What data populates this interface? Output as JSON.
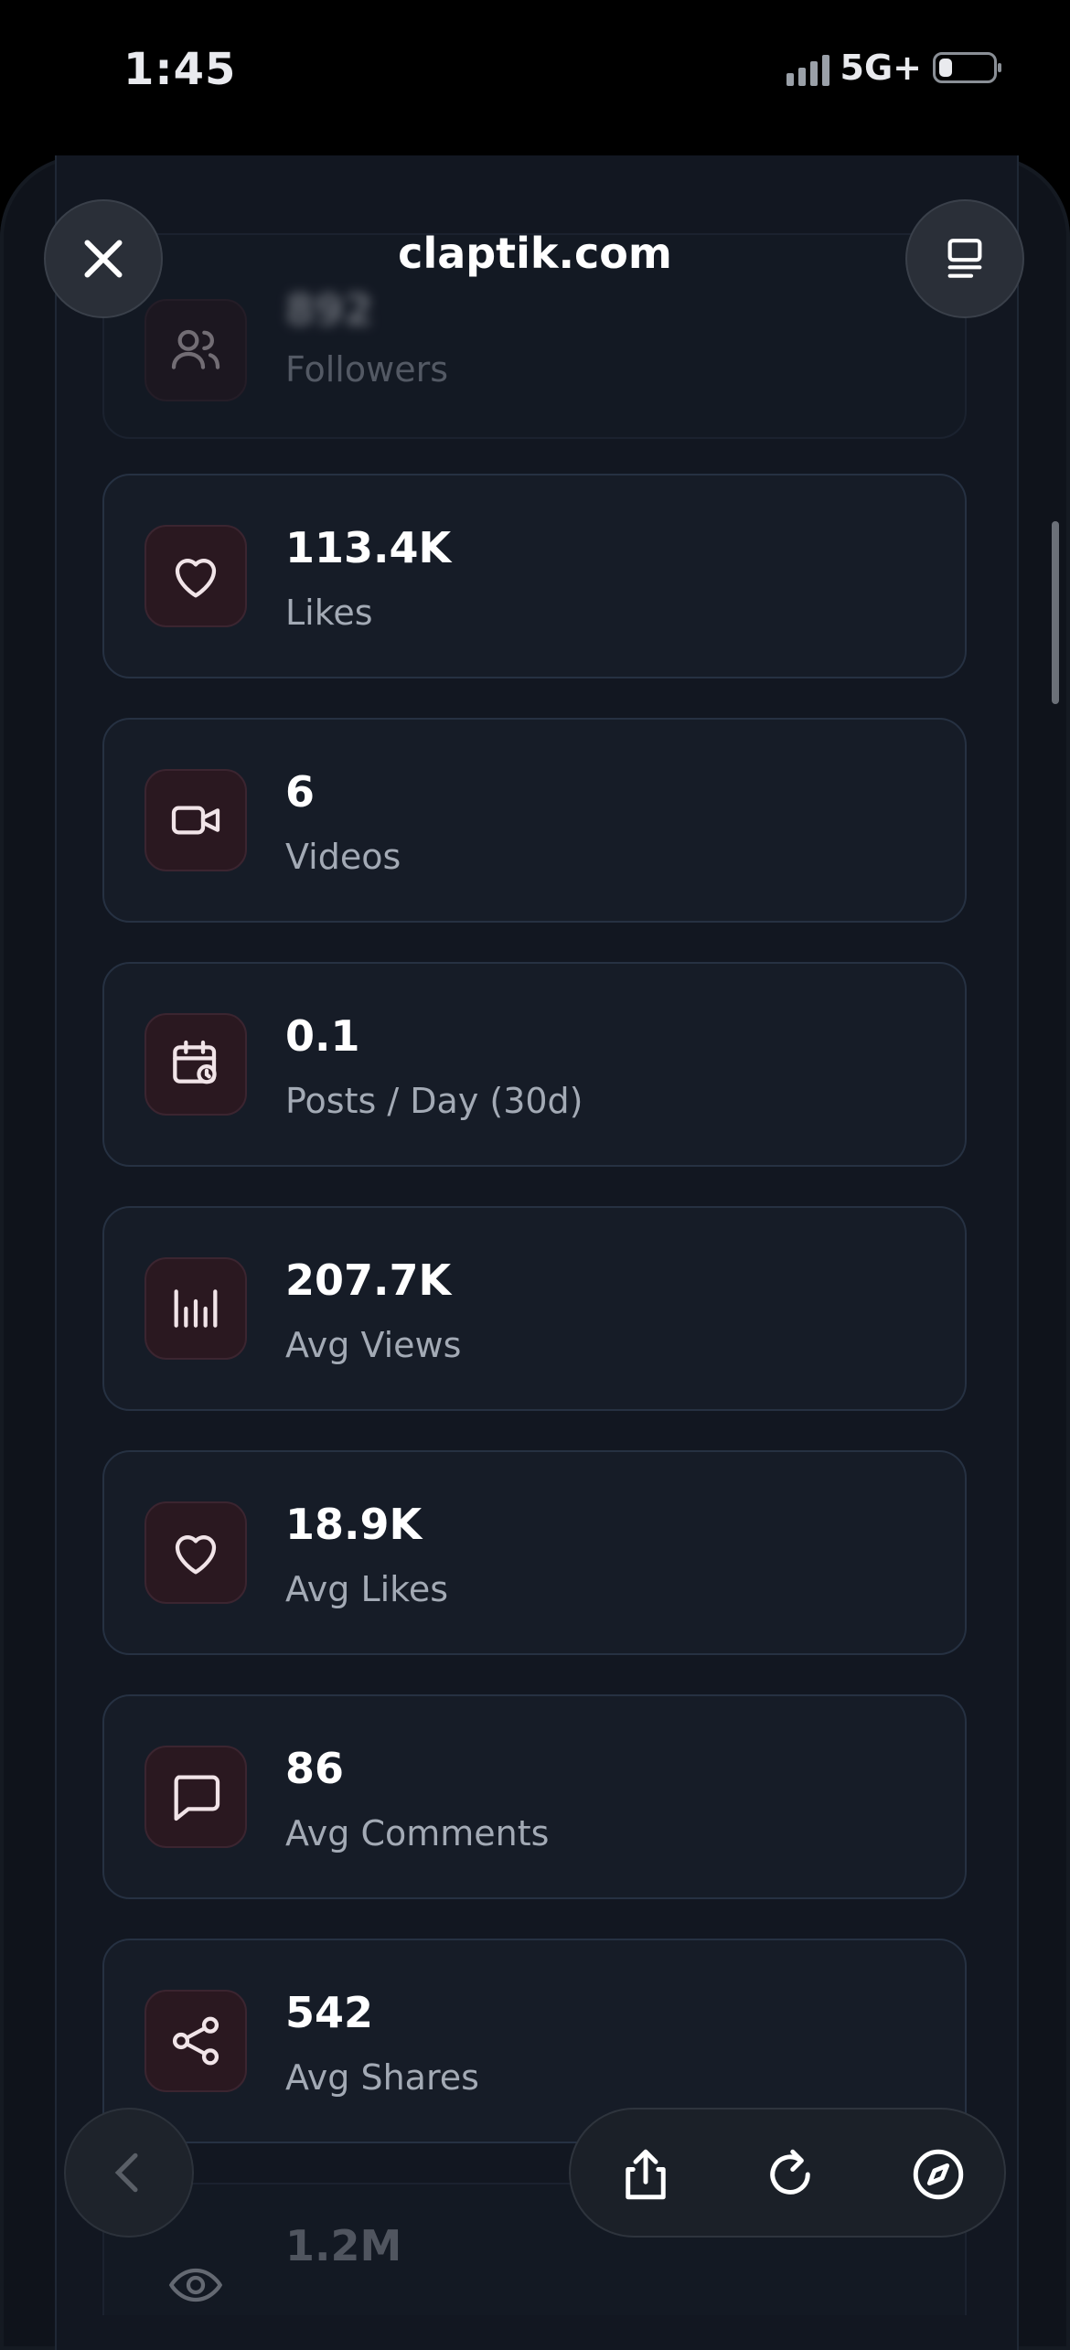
{
  "status_bar": {
    "time": "1:45",
    "network": "5G+"
  },
  "header": {
    "site": "claptik.com",
    "close_icon": "close-icon",
    "menu_icon": "reader-menu-icon"
  },
  "stats": [
    {
      "value": "892",
      "label": "Followers",
      "icon": "followers-icon"
    },
    {
      "value": "113.4K",
      "label": "Likes",
      "icon": "heart-icon"
    },
    {
      "value": "6",
      "label": "Videos",
      "icon": "video-icon"
    },
    {
      "value": "0.1",
      "label": "Posts / Day (30d)",
      "icon": "calendar-clock-icon"
    },
    {
      "value": "207.7K",
      "label": "Avg Views",
      "icon": "bar-chart-icon"
    },
    {
      "value": "18.9K",
      "label": "Avg Likes",
      "icon": "heart-icon"
    },
    {
      "value": "86",
      "label": "Avg Comments",
      "icon": "comment-icon"
    },
    {
      "value": "542",
      "label": "Avg Shares",
      "icon": "share-icon"
    },
    {
      "value": "1.2M",
      "label": "",
      "icon": "eye-icon"
    }
  ],
  "toolbar": {
    "back_icon": "back-chevron-icon",
    "share_icon": "share-upload-icon",
    "reload_icon": "reload-icon",
    "safari_icon": "compass-icon"
  },
  "colors": {
    "background": "#0f131b",
    "card": "#161c27",
    "icon_box": "#2a1820",
    "label": "#a3aab5"
  }
}
